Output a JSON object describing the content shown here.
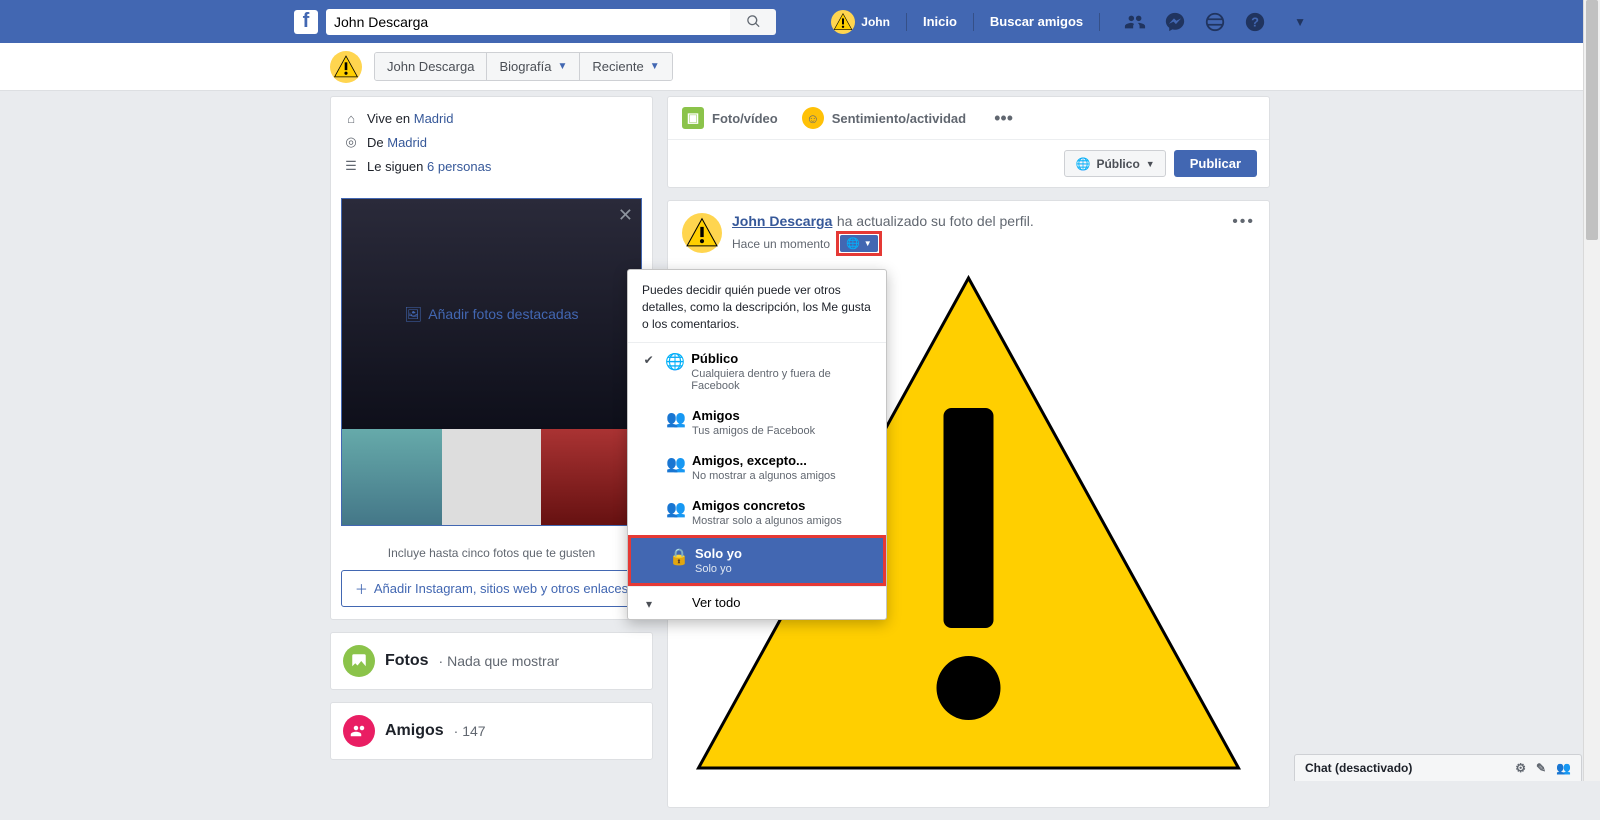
{
  "topbar": {
    "search_value": "John Descarga",
    "user_name": "John",
    "nav_home": "Inicio",
    "nav_find": "Buscar amigos"
  },
  "profile_bar": {
    "name": "John Descarga",
    "tab_bio": "Biografía",
    "tab_recent": "Reciente"
  },
  "intro": {
    "lives_prefix": "Vive en ",
    "lives_link": "Madrid",
    "from_prefix": "De ",
    "from_link": "Madrid",
    "followers_prefix": "Le siguen ",
    "followers_link": "6 personas"
  },
  "featured": {
    "add_label": "Añadir fotos destacadas",
    "caption": "Incluye hasta cinco fotos que te gusten",
    "add_links": "Añadir Instagram, sitios web y otros enlaces"
  },
  "sections": {
    "photos_title": "Fotos",
    "photos_sub": "Nada que mostrar",
    "friends_title": "Amigos",
    "friends_count": "147"
  },
  "composer": {
    "photo_video": "Foto/vídeo",
    "feeling": "Sentimiento/actividad",
    "audience": "Público",
    "publish": "Publicar"
  },
  "post": {
    "author": "John Descarga",
    "action": " ha actualizado su foto del perfil.",
    "time": "Hace un momento"
  },
  "dropdown": {
    "intro": "Puedes decidir quién puede ver otros detalles, como la descripción, los Me gusta o los comentarios.",
    "public_label": "Público",
    "public_sub": "Cualquiera dentro y fuera de Facebook",
    "friends_label": "Amigos",
    "friends_sub": "Tus amigos de Facebook",
    "friends_except_label": "Amigos, excepto...",
    "friends_except_sub": "No mostrar a algunos amigos",
    "specific_label": "Amigos concretos",
    "specific_sub": "Mostrar solo a algunos amigos",
    "only_me_label": "Solo yo",
    "only_me_sub": "Solo yo",
    "see_all": "Ver todo"
  },
  "chat": {
    "label": "Chat (desactivado)"
  }
}
